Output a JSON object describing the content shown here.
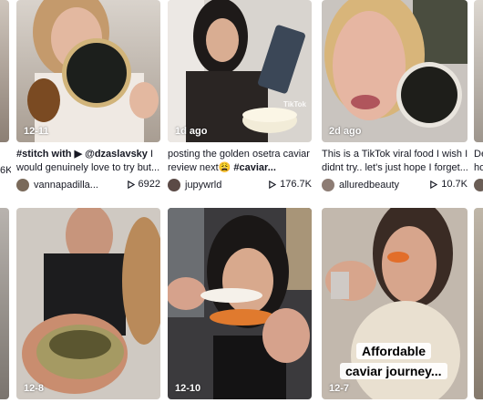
{
  "videos": [
    {
      "date": "12-11",
      "caption_prefix": "#stitch with",
      "mention": "@dzaslavsky",
      "caption_rest": " I",
      "caption_line2": "would genuinely love to try but...",
      "author": "vannapadilla...",
      "views": "6922"
    },
    {
      "date": "1d ago",
      "caption_line1": "posting the golden osetra caviar",
      "caption_line2_a": "review next😩 ",
      "caption_line2_tag": "#caviar...",
      "author": "jupywrld",
      "views": "176.7K",
      "watermark": "TikTok"
    },
    {
      "date": "2d ago",
      "caption_line1": "This is a TikTok viral food I wish I",
      "caption_line2": "didnt try.. let's just hope I forget...",
      "author": "alluredbeauty",
      "views": "10.7K"
    },
    {
      "date": "12-8"
    },
    {
      "date": "12-10"
    },
    {
      "date": "12-7",
      "overlay_line1": "Affordable",
      "overlay_line2": "caviar journey..."
    }
  ],
  "edge_left": {
    "views_partial": "6K"
  },
  "edge_right": {
    "caption_partial_1": "De",
    "caption_partial_2": "ho"
  }
}
